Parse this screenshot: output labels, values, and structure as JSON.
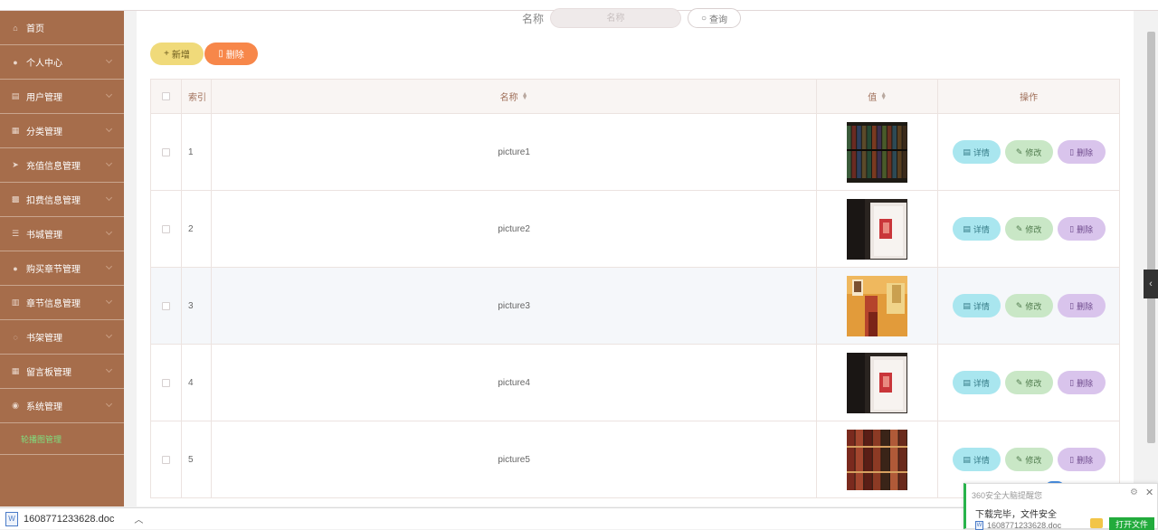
{
  "sidebar": {
    "items": [
      {
        "label": "首页",
        "icon": "home-icon",
        "glyph": "⌂",
        "expandable": false
      },
      {
        "label": "个人中心",
        "icon": "user-icon",
        "glyph": "●",
        "expandable": true
      },
      {
        "label": "用户管理",
        "icon": "users-icon",
        "glyph": "▤",
        "expandable": true
      },
      {
        "label": "分类管理",
        "icon": "category-icon",
        "glyph": "▦",
        "expandable": true
      },
      {
        "label": "充值信息管理",
        "icon": "send-icon",
        "glyph": "➤",
        "expandable": true
      },
      {
        "label": "扣费信息管理",
        "icon": "grid-icon",
        "glyph": "▩",
        "expandable": true
      },
      {
        "label": "书城管理",
        "icon": "sliders-icon",
        "glyph": "☰",
        "expandable": true
      },
      {
        "label": "购买章节管理",
        "icon": "person-icon",
        "glyph": "●",
        "expandable": true
      },
      {
        "label": "章节信息管理",
        "icon": "bars-icon",
        "glyph": "▥",
        "expandable": true
      },
      {
        "label": "书架管理",
        "icon": "power-icon",
        "glyph": "◌",
        "expandable": true
      },
      {
        "label": "留言板管理",
        "icon": "board-icon",
        "glyph": "▦",
        "expandable": true
      },
      {
        "label": "系统管理",
        "icon": "pin-icon",
        "glyph": "◉",
        "expandable": true
      }
    ],
    "sub_item": "轮播图管理"
  },
  "search": {
    "label": "名称",
    "placeholder": "名称",
    "button": "查询"
  },
  "actions": {
    "add": "新增",
    "delete": "删除"
  },
  "table": {
    "headers": {
      "index": "索引",
      "name": "名称",
      "value": "值",
      "ops": "操作"
    },
    "rows": [
      {
        "index": "1",
        "name": "picture1",
        "thumb": "books-shelf"
      },
      {
        "index": "2",
        "name": "picture2",
        "thumb": "open-book-dark"
      },
      {
        "index": "3",
        "name": "picture3",
        "thumb": "warm-books"
      },
      {
        "index": "4",
        "name": "picture4",
        "thumb": "open-book-dark"
      },
      {
        "index": "5",
        "name": "picture5",
        "thumb": "red-books"
      }
    ],
    "ops": {
      "detail": "详情",
      "edit": "修改",
      "remove": "删除"
    }
  },
  "download_bar": {
    "file": "1608771233628.doc"
  },
  "popup": {
    "title": "360安全大脑提醒您",
    "message": "下载完毕，文件安全",
    "file": "1608771233628.doc",
    "open_button": "打开文件"
  },
  "colors": {
    "sidebar": "#a66d4b",
    "add_button": "#f0da7a",
    "delete_button": "#f7874a",
    "detail_button": "#a9e6ef",
    "edit_button": "#c9e7c6",
    "remove_button": "#d9c4ec"
  }
}
